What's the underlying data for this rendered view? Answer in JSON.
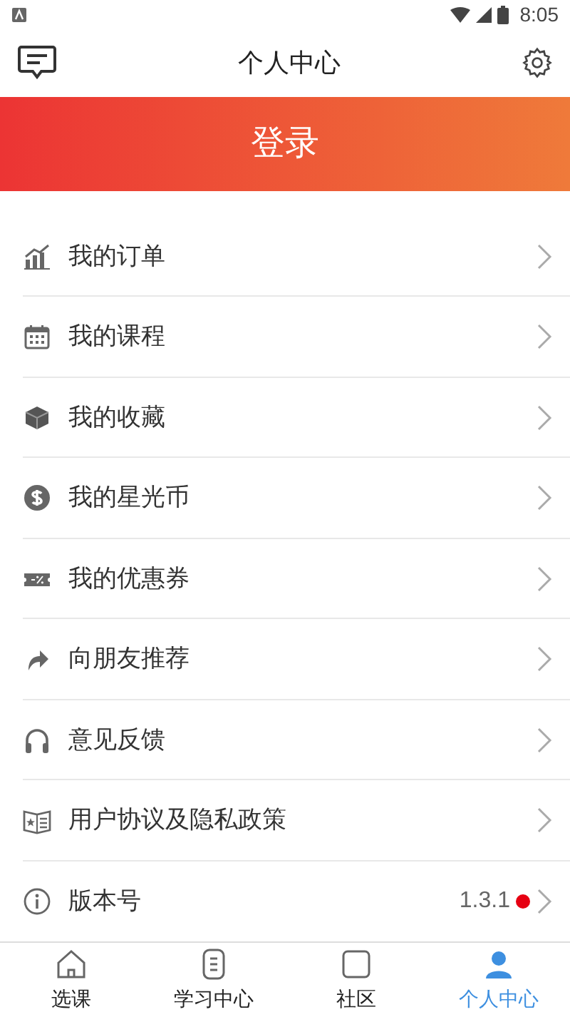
{
  "status_bar": {
    "time": "8:05"
  },
  "header": {
    "title": "个人中心"
  },
  "login_banner": {
    "label": "登录"
  },
  "menu": [
    {
      "kind": "link",
      "label": "我的订单"
    },
    {
      "kind": "link",
      "label": "我的课程"
    },
    {
      "kind": "link",
      "label": "我的收藏"
    },
    {
      "kind": "link",
      "label": "我的星光币"
    },
    {
      "kind": "link",
      "label": "我的优惠券"
    },
    {
      "kind": "link",
      "label": "向朋友推荐"
    },
    {
      "kind": "link",
      "label": "意见反馈"
    },
    {
      "kind": "link",
      "label": "用户协议及隐私政策"
    },
    {
      "kind": "version",
      "label": "版本号",
      "value": "1.3.1",
      "badge": true
    }
  ],
  "tab_bar": [
    {
      "label": "选课",
      "selected": false
    },
    {
      "label": "学习中心",
      "selected": false
    },
    {
      "label": "社区",
      "selected": false
    },
    {
      "label": "个人中心",
      "selected": true
    }
  ]
}
